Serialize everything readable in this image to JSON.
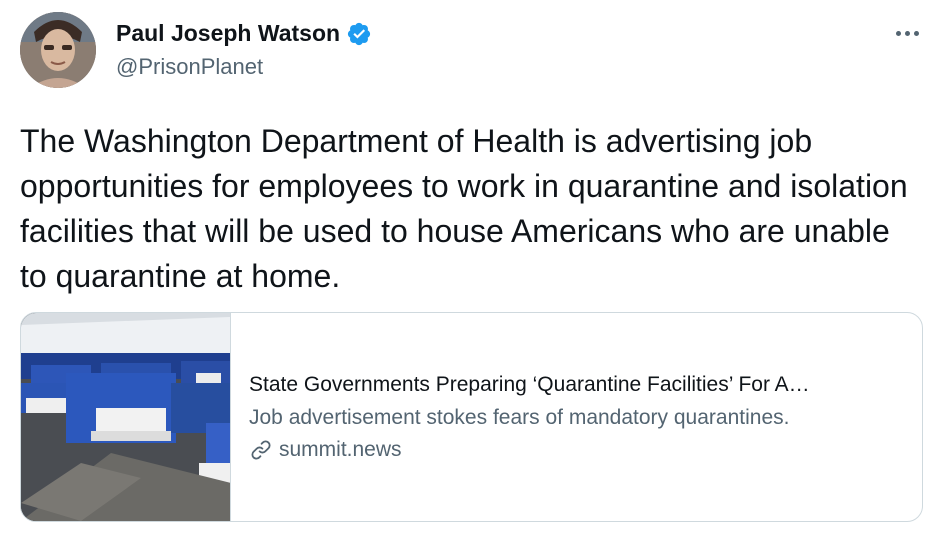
{
  "author": {
    "display_name": "Paul Joseph Watson",
    "handle": "@PrisonPlanet",
    "verified": true
  },
  "tweet": {
    "text": "The Washington Department of Health is advertising job opportunities for employees to work in quarantine and isolation facilities that will be used to house Americans who are unable to quarantine at home."
  },
  "card": {
    "title": "State Governments Preparing ‘Quarantine Facilities’ For A…",
    "description": "Job advertisement stokes fears of mandatory quarantines.",
    "domain": "summit.news"
  },
  "icons": {
    "verified": "verified-badge-icon",
    "more": "more-options-icon",
    "link": "link-icon"
  },
  "colors": {
    "verified_blue": "#1d9bf0",
    "secondary_text": "#536471",
    "primary_text": "#0f1419",
    "card_border": "#cfd9de"
  }
}
